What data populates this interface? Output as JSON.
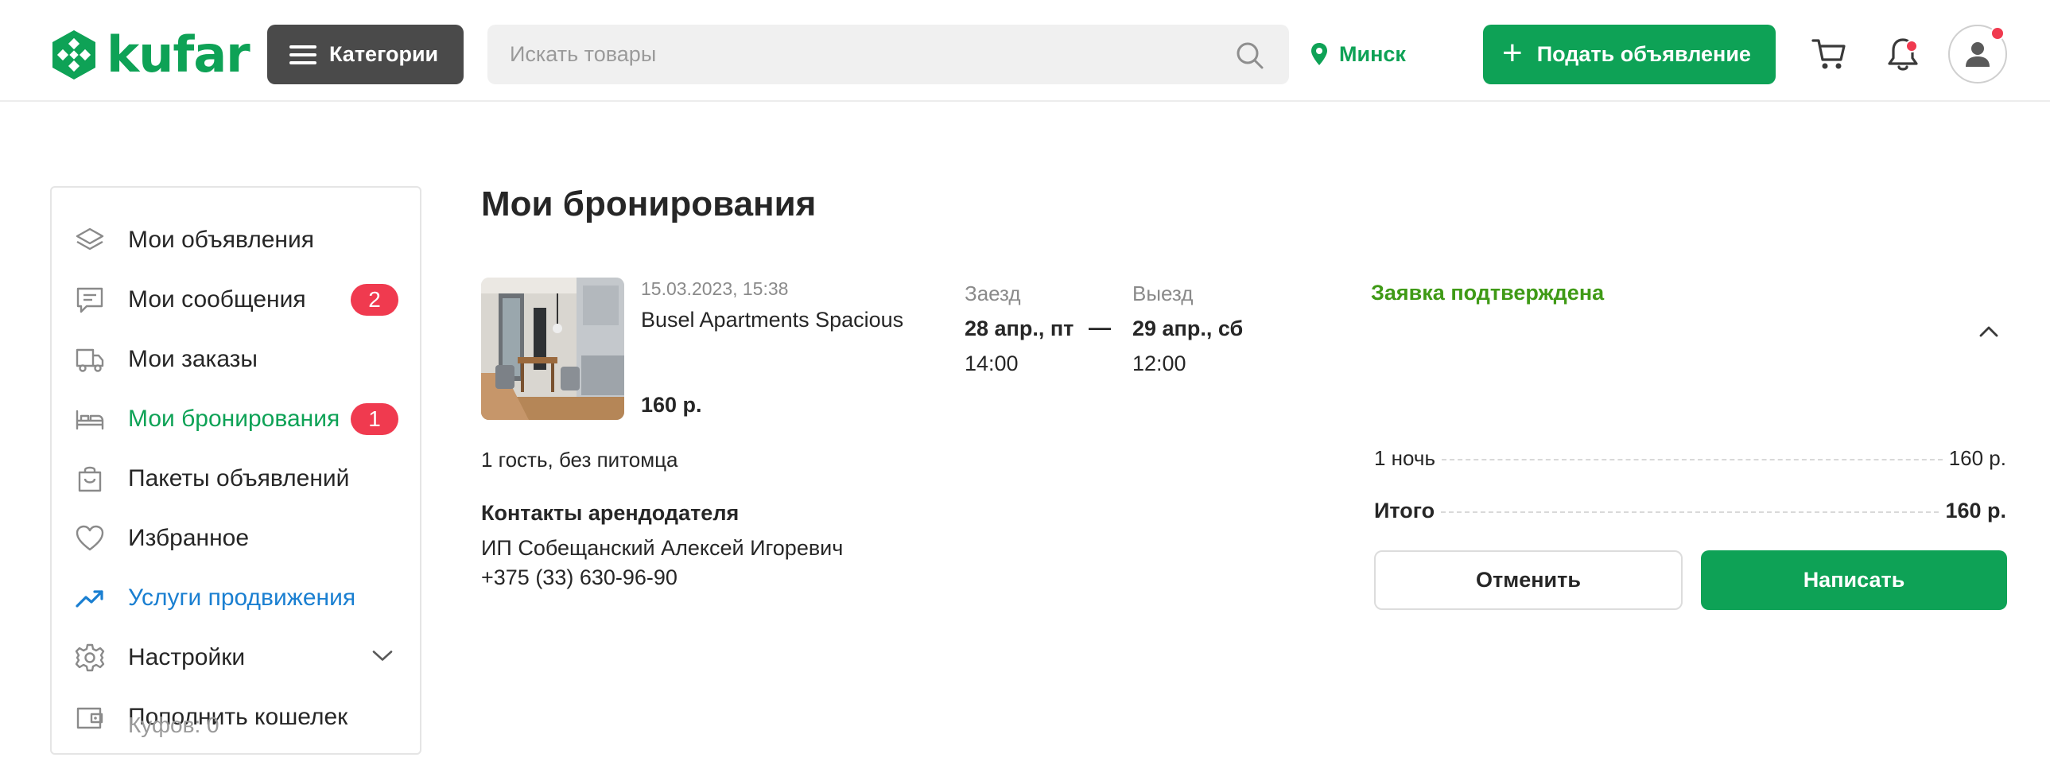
{
  "header": {
    "logo_text": "kufar",
    "categories_label": "Категории",
    "search_placeholder": "Искать товары",
    "city": "Минск",
    "post_ad_label": "Подать объявление",
    "brand_color": "#0ea256",
    "notification_color": "#f03a4f"
  },
  "sidebar": {
    "items": [
      {
        "label": "Мои объявления",
        "icon": "layers-icon"
      },
      {
        "label": "Мои сообщения",
        "icon": "message-icon",
        "badge": "2"
      },
      {
        "label": "Мои заказы",
        "icon": "delivery-truck-icon"
      },
      {
        "label": "Мои бронирования",
        "icon": "bed-icon",
        "badge": "1",
        "active": true
      },
      {
        "label": "Пакеты объявлений",
        "icon": "shopping-bag-icon"
      },
      {
        "label": "Избранное",
        "icon": "heart-icon"
      },
      {
        "label": "Услуги продвижения",
        "icon": "trending-up-icon"
      },
      {
        "label": "Настройки",
        "icon": "gear-icon"
      },
      {
        "label": "Пополнить кошелек",
        "icon": "wallet-icon"
      }
    ],
    "wallet_balance": "Куфов: 0"
  },
  "main": {
    "title": "Мои бронирования",
    "booking": {
      "created": "15.03.2023, 15:38",
      "name": "Busel Apartments Spacious",
      "price": "160 р.",
      "checkin_label": "Заезд",
      "checkin_date": "28 апр., пт",
      "checkin_time": "14:00",
      "separator": "—",
      "checkout_label": "Выезд",
      "checkout_date": "29 апр., сб",
      "checkout_time": "12:00",
      "status": "Заявка подтверждена",
      "status_color": "#3f9a16",
      "guests": "1 гость, без питомца",
      "contacts_title": "Контакты арендодателя",
      "landlord": "ИП Собещанский Алексей Игоревич",
      "phone": "+375 (33) 630-96-90",
      "nights_label": "1 ночь",
      "nights_price": "160 р.",
      "total_label": "Итого",
      "total_price": "160 р.",
      "cancel_label": "Отменить",
      "write_label": "Написать"
    }
  }
}
